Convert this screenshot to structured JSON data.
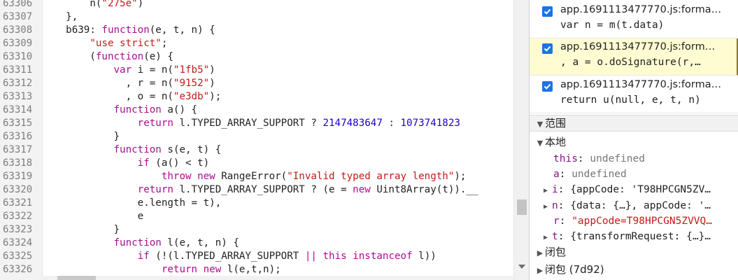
{
  "editor": {
    "lines": [
      {
        "n": "63306",
        "tokens": [
          {
            "c": "plain",
            "t": "        n("
          },
          {
            "c": "str",
            "t": "\"275e\""
          },
          {
            "c": "plain",
            "t": ")"
          }
        ]
      },
      {
        "n": "63307",
        "tokens": [
          {
            "c": "plain",
            "t": "    },"
          }
        ]
      },
      {
        "n": "63308",
        "tokens": [
          {
            "c": "plain",
            "t": "    b639: "
          },
          {
            "c": "kw",
            "t": "function"
          },
          {
            "c": "plain",
            "t": "(e, t, n) {"
          }
        ]
      },
      {
        "n": "63309",
        "tokens": [
          {
            "c": "plain",
            "t": "        "
          },
          {
            "c": "str",
            "t": "\"use strict\""
          },
          {
            "c": "plain",
            "t": ";"
          }
        ]
      },
      {
        "n": "63310",
        "tokens": [
          {
            "c": "plain",
            "t": "        ("
          },
          {
            "c": "kw",
            "t": "function"
          },
          {
            "c": "plain",
            "t": "(e) {"
          }
        ]
      },
      {
        "n": "63311",
        "tokens": [
          {
            "c": "plain",
            "t": "            "
          },
          {
            "c": "kw",
            "t": "var"
          },
          {
            "c": "plain",
            "t": " i = n("
          },
          {
            "c": "str",
            "t": "\"1fb5\""
          },
          {
            "c": "plain",
            "t": ")"
          }
        ]
      },
      {
        "n": "63312",
        "tokens": [
          {
            "c": "plain",
            "t": "              , r = n("
          },
          {
            "c": "str",
            "t": "\"9152\""
          },
          {
            "c": "plain",
            "t": ")"
          }
        ]
      },
      {
        "n": "63313",
        "tokens": [
          {
            "c": "plain",
            "t": "              , o = n("
          },
          {
            "c": "str",
            "t": "\"e3db\""
          },
          {
            "c": "plain",
            "t": ");"
          }
        ]
      },
      {
        "n": "63314",
        "tokens": [
          {
            "c": "plain",
            "t": "            "
          },
          {
            "c": "kw",
            "t": "function"
          },
          {
            "c": "plain",
            "t": " a() {"
          }
        ]
      },
      {
        "n": "63315",
        "tokens": [
          {
            "c": "plain",
            "t": "                "
          },
          {
            "c": "kw",
            "t": "return"
          },
          {
            "c": "plain",
            "t": " l.TYPED_ARRAY_SUPPORT ? "
          },
          {
            "c": "num",
            "t": "2147483647"
          },
          {
            "c": "plain",
            "t": " : "
          },
          {
            "c": "num",
            "t": "1073741823"
          }
        ]
      },
      {
        "n": "63316",
        "tokens": [
          {
            "c": "plain",
            "t": "            }"
          }
        ]
      },
      {
        "n": "63317",
        "tokens": [
          {
            "c": "plain",
            "t": "            "
          },
          {
            "c": "kw",
            "t": "function"
          },
          {
            "c": "plain",
            "t": " s(e, t) {"
          }
        ]
      },
      {
        "n": "63318",
        "tokens": [
          {
            "c": "plain",
            "t": "                "
          },
          {
            "c": "kw",
            "t": "if"
          },
          {
            "c": "plain",
            "t": " (a() < t)"
          }
        ]
      },
      {
        "n": "63319",
        "tokens": [
          {
            "c": "plain",
            "t": "                    "
          },
          {
            "c": "kw",
            "t": "throw new"
          },
          {
            "c": "plain",
            "t": " RangeError("
          },
          {
            "c": "str",
            "t": "\"Invalid typed array length\""
          },
          {
            "c": "plain",
            "t": ");"
          }
        ]
      },
      {
        "n": "63320",
        "tokens": [
          {
            "c": "plain",
            "t": "                "
          },
          {
            "c": "kw",
            "t": "return"
          },
          {
            "c": "plain",
            "t": " l.TYPED_ARRAY_SUPPORT ? (e = "
          },
          {
            "c": "kw",
            "t": "new"
          },
          {
            "c": "plain",
            "t": " Uint8Array(t)).__"
          }
        ]
      },
      {
        "n": "63321",
        "tokens": [
          {
            "c": "plain",
            "t": "                e.length = t),"
          }
        ]
      },
      {
        "n": "63322",
        "tokens": [
          {
            "c": "plain",
            "t": "                e"
          }
        ]
      },
      {
        "n": "63323",
        "tokens": [
          {
            "c": "plain",
            "t": "            }"
          }
        ]
      },
      {
        "n": "63324",
        "tokens": [
          {
            "c": "plain",
            "t": "            "
          },
          {
            "c": "kw",
            "t": "function"
          },
          {
            "c": "plain",
            "t": " l(e, t, n) {"
          }
        ]
      },
      {
        "n": "63325",
        "tokens": [
          {
            "c": "plain",
            "t": "                "
          },
          {
            "c": "kw",
            "t": "if"
          },
          {
            "c": "plain",
            "t": " (!(l.TYPED_ARRAY_SUPPORT "
          },
          {
            "c": "kw",
            "t": "||"
          },
          {
            "c": "plain",
            "t": " "
          },
          {
            "c": "kw",
            "t": "this instanceof"
          },
          {
            "c": "plain",
            "t": " l))"
          }
        ]
      },
      {
        "n": "63326",
        "tokens": [
          {
            "c": "plain",
            "t": "                    "
          },
          {
            "c": "kw",
            "t": "return new"
          },
          {
            "c": "plain",
            "t": " l(e,t,n);"
          }
        ]
      }
    ]
  },
  "callstack": [
    {
      "file": "app.1691113477770.js:forma…",
      "code": "var n = m(t.data)",
      "checked": true,
      "highlight": false
    },
    {
      "file": "app.1691113477770.js:form…",
      "code": ", a = o.doSignature(r,…",
      "checked": true,
      "highlight": true
    },
    {
      "file": "app.1691113477770.js:forma…",
      "code": "return u(null, e, t, n)",
      "checked": true,
      "highlight": false
    }
  ],
  "scope": {
    "header": "范围",
    "local_label": "本地",
    "vars": [
      {
        "name": "this",
        "sep": ": ",
        "value": "undefined",
        "vclass": "vgray",
        "expandable": false
      },
      {
        "name": "a",
        "sep": ": ",
        "value": "undefined",
        "vclass": "vgray",
        "expandable": false
      },
      {
        "name": "i",
        "sep": ": ",
        "value": "{appCode: 'T98HPCGN5ZV…",
        "vclass": "vplain",
        "expandable": true
      },
      {
        "name": "n",
        "sep": ": ",
        "value": "{data: {…}, appCode: '…",
        "vclass": "vplain",
        "expandable": true
      },
      {
        "name": "r",
        "sep": ": ",
        "value": "\"appCode=T98HPCGN5ZVVQ…",
        "vclass": "vstr",
        "expandable": false
      },
      {
        "name": "t",
        "sep": ": ",
        "value": "{transformRequest: {…}…",
        "vclass": "vplain",
        "expandable": true
      }
    ],
    "closure1": "闭包",
    "closure2": "闭包 (7d92)"
  }
}
